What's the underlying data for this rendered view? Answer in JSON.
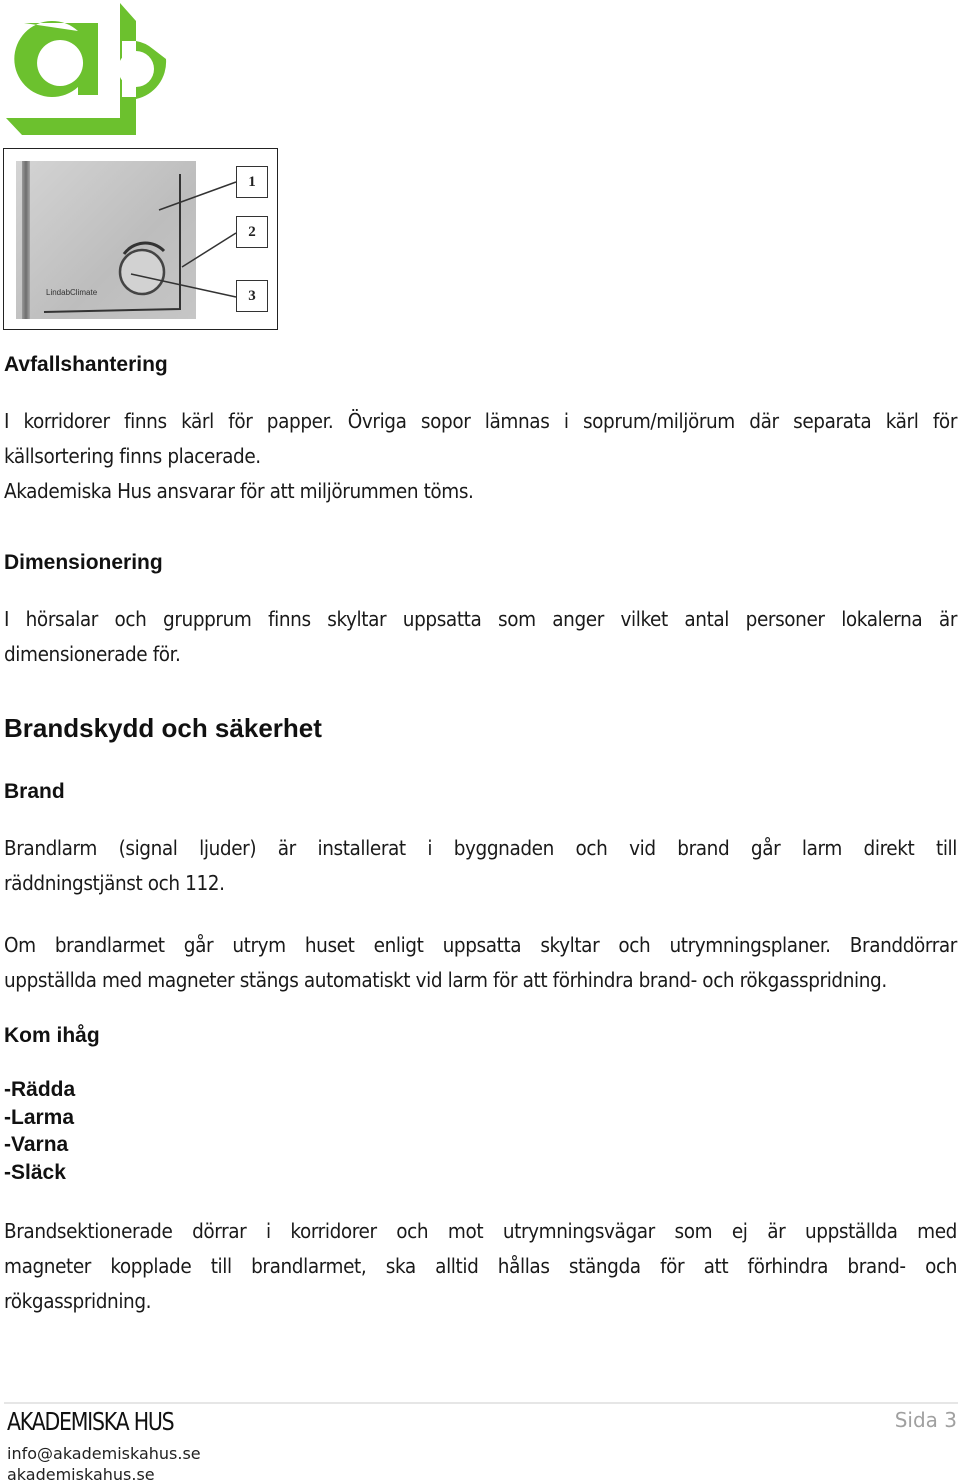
{
  "brand": {
    "logo_name": "akademiska-hus-logo",
    "logo_color": "#6cc12e"
  },
  "figure": {
    "device_brand": "LindabClimate",
    "callouts": [
      "1",
      "2",
      "3"
    ]
  },
  "sections": {
    "avfall": {
      "heading": "Avfallshantering",
      "lines": [
        "I korridorer finns kärl för papper. Övriga sopor lämnas i soprum/miljörum där separata kärl för",
        "källsortering finns placerade.",
        "Akademiska Hus ansvarar för att miljörummen töms."
      ]
    },
    "dimensionering": {
      "heading": "Dimensionering",
      "lines": [
        "I hörsalar och grupprum finns skyltar uppsatta som anger vilket antal personer lokalerna är",
        "dimensionerade för."
      ]
    },
    "brandskydd": {
      "heading": "Brandskydd och säkerhet",
      "brand_heading": "Brand",
      "p1": [
        "Brandlarm (signal ljuder) är installerat i byggnaden och vid brand går larm direkt till",
        "räddningstjänst och 112."
      ],
      "p2": [
        "Om brandlarmet går utrym huset enligt uppsatta skyltar och utrymningsplaner. Branddörrar",
        "uppställda med magneter stängs automatiskt vid larm för att förhindra brand- och rökgasspridning."
      ],
      "remember_heading": "Kom ihåg",
      "remember_items": [
        "-Rädda",
        "-Larma",
        "-Varna",
        "-Släck"
      ],
      "p3": [
        "Brandsektionerade dörrar i korridorer och mot utrymningsvägar som ej är uppställda med",
        "magneter kopplade till brandlarmet, ska alltid hållas stängda för att förhindra brand- och",
        "rökgasspridning."
      ]
    }
  },
  "footer": {
    "company": "AKADEMISKA HUS",
    "email": "info@akademiskahus.se",
    "website": "akademiskahus.se",
    "page_label": "Sida 3"
  }
}
